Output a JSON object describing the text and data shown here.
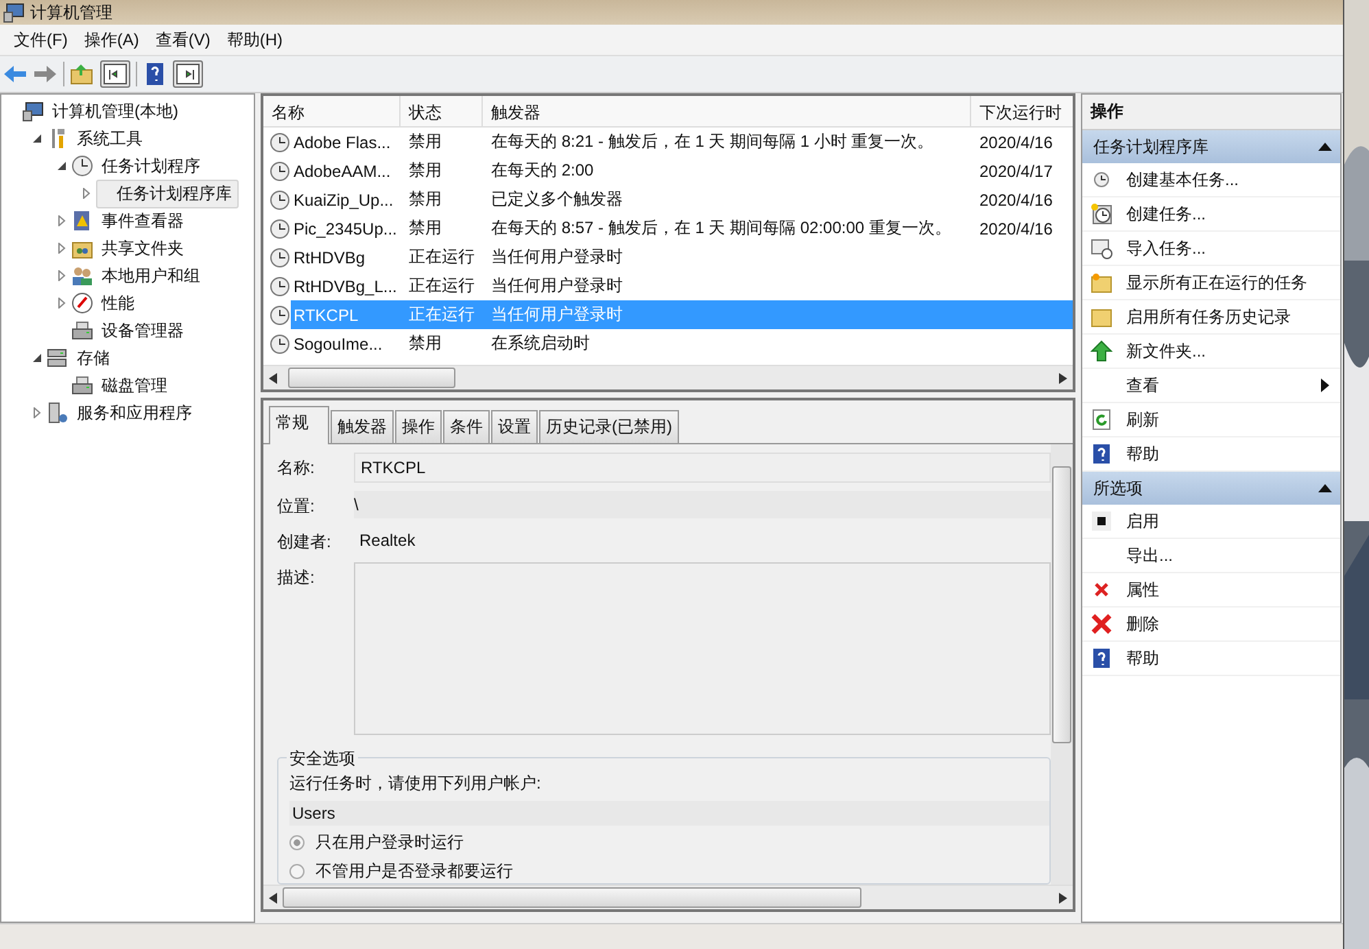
{
  "window": {
    "title": "计算机管理"
  },
  "menu": [
    "文件(F)",
    "操作(A)",
    "查看(V)",
    "帮助(H)"
  ],
  "tree": [
    {
      "label": "计算机管理(本地)",
      "kind": "computer",
      "selected": false,
      "children": [
        {
          "label": "系统工具",
          "kind": "tools",
          "selected": false,
          "expanded": true,
          "children": [
            {
              "label": "任务计划程序",
              "kind": "clock",
              "selected": false,
              "expanded": true,
              "children": [
                {
                  "label": "任务计划程序库",
                  "kind": "none",
                  "selected": true,
                  "expanded": false
                }
              ]
            },
            {
              "label": "事件查看器",
              "kind": "log",
              "selected": false,
              "expanded": false
            },
            {
              "label": "共享文件夹",
              "kind": "shared",
              "selected": false,
              "expanded": false
            },
            {
              "label": "本地用户和组",
              "kind": "users",
              "selected": false,
              "expanded": false
            },
            {
              "label": "性能",
              "kind": "gauge",
              "selected": false,
              "expanded": false
            },
            {
              "label": "设备管理器",
              "kind": "device",
              "selected": false
            }
          ]
        },
        {
          "label": "存储",
          "kind": "storage",
          "selected": false,
          "expanded": true,
          "children": [
            {
              "label": "磁盘管理",
              "kind": "device",
              "selected": false
            }
          ]
        },
        {
          "label": "服务和应用程序",
          "kind": "services",
          "selected": false,
          "expanded": false
        }
      ]
    }
  ],
  "tasks": {
    "columns": [
      "名称",
      "状态",
      "触发器",
      "下次运行时"
    ],
    "rows": [
      {
        "name": "Adobe Flas...",
        "status": "禁用",
        "trigger": "在每天的 8:21 - 触发后，在 1 天 期间每隔 1 小时 重复一次。",
        "next_run": "2020/4/16",
        "selected": false
      },
      {
        "name": "AdobeAAM...",
        "status": "禁用",
        "trigger": "在每天的 2:00",
        "next_run": "2020/4/17",
        "selected": false
      },
      {
        "name": "KuaiZip_Up...",
        "status": "禁用",
        "trigger": "已定义多个触发器",
        "next_run": "2020/4/16",
        "selected": false
      },
      {
        "name": "Pic_2345Up...",
        "status": "禁用",
        "trigger": "在每天的 8:57 - 触发后，在 1 天 期间每隔 02:00:00 重复一次。",
        "next_run": "2020/4/16",
        "selected": false
      },
      {
        "name": "RtHDVBg",
        "status": "正在运行",
        "trigger": "当任何用户登录时",
        "selected": false
      },
      {
        "name": "RtHDVBg_L...",
        "status": "正在运行",
        "trigger": "当任何用户登录时",
        "selected": false
      },
      {
        "name": "RTKCPL",
        "status": "正在运行",
        "trigger": "当任何用户登录时",
        "selected": true
      },
      {
        "name": "SogouIme...",
        "status": "禁用",
        "trigger": "在系统启动时",
        "selected": false
      }
    ]
  },
  "tabs": [
    {
      "label": "常规",
      "selected": true
    },
    {
      "label": "触发器",
      "selected": false
    },
    {
      "label": "操作",
      "selected": false
    },
    {
      "label": "条件",
      "selected": false
    },
    {
      "label": "设置",
      "selected": false
    },
    {
      "label": "历史记录(已禁用)",
      "selected": false
    }
  ],
  "details": [
    {
      "label": "名称:",
      "kind": "input",
      "value": "RTKCPL"
    },
    {
      "label": "位置:",
      "kind": "readonly",
      "value": "\\"
    },
    {
      "label": "创建者:",
      "kind": "text",
      "value": "Realtek"
    },
    {
      "label": "描述:",
      "kind": "textarea"
    }
  ],
  "security": {
    "title": "安全选项",
    "prompt": "运行任务时，请使用下列用户帐户:",
    "account": "Users",
    "options": [
      {
        "label": "只在用户登录时运行",
        "selected": true
      },
      {
        "label": "不管用户是否登录都要运行",
        "selected": false
      }
    ]
  },
  "actions": {
    "title": "操作",
    "sections": [
      {
        "title": "任务计划程序库",
        "expanded": true,
        "items": [
          {
            "label": "创建基本任务...",
            "kind": "clock"
          },
          {
            "label": "创建任务...",
            "kind": "clock-star"
          },
          {
            "label": "导入任务...",
            "kind": "import"
          },
          {
            "label": "显示所有正在运行的任务",
            "kind": "folder-star"
          },
          {
            "label": "启用所有任务历史记录",
            "kind": "folder"
          },
          {
            "label": "新文件夹...",
            "kind": "up-arrow"
          },
          {
            "label": "查看",
            "kind": "none",
            "submenu": true
          },
          {
            "label": "刷新",
            "kind": "refresh"
          },
          {
            "label": "帮助",
            "kind": "help"
          }
        ]
      },
      {
        "title": "所选项",
        "expanded": true,
        "items": [
          {
            "label": "启用",
            "kind": "stop"
          },
          {
            "label": "导出...",
            "kind": "none"
          },
          {
            "label": "属性",
            "kind": "small-x"
          },
          {
            "label": "删除",
            "kind": "x"
          },
          {
            "label": "帮助",
            "kind": "help"
          }
        ]
      }
    ]
  }
}
